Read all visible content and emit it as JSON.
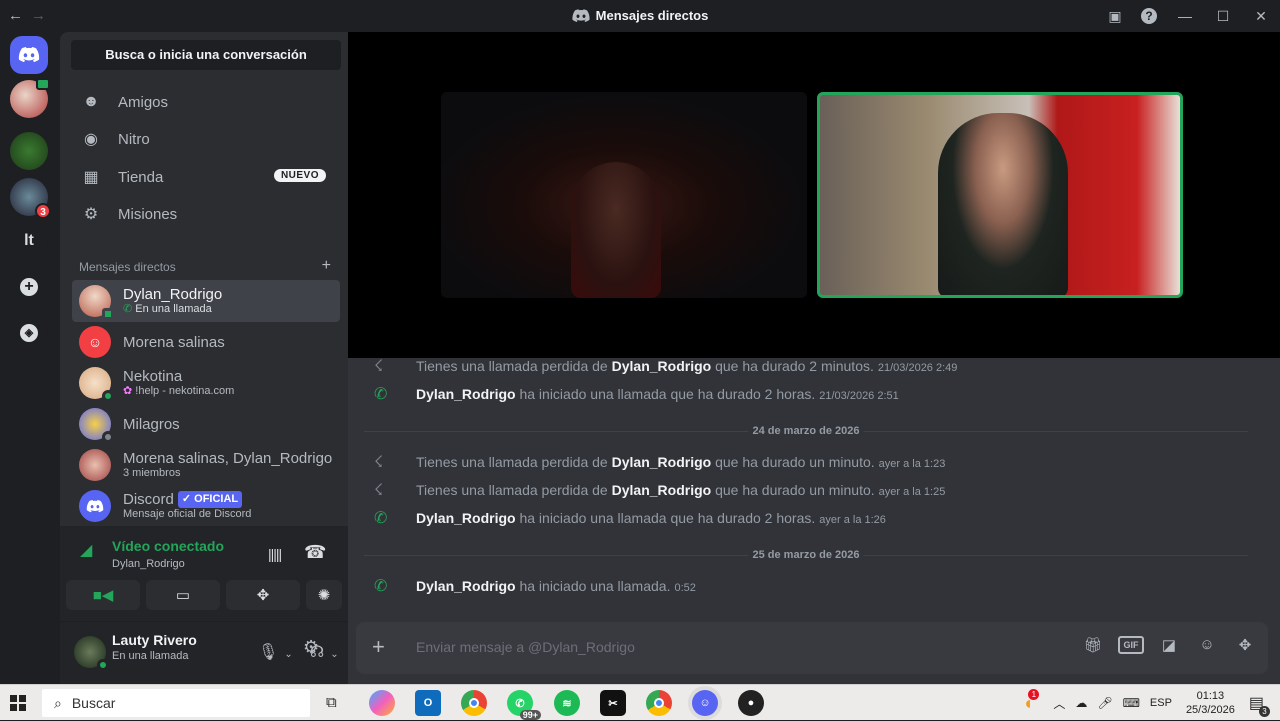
{
  "titlebar": {
    "title": "Mensajes directos",
    "back": "←",
    "forward": "→"
  },
  "sidebar": {
    "search": "Busca o inicia una conversación",
    "nav": [
      {
        "label": "Amigos",
        "icon": "friends-icon",
        "glyph": "☻"
      },
      {
        "label": "Nitro",
        "icon": "nitro-icon",
        "glyph": "◉"
      },
      {
        "label": "Tienda",
        "icon": "shop-icon",
        "glyph": "▦",
        "badge": "NUEVO"
      },
      {
        "label": "Misiones",
        "icon": "quests-icon",
        "glyph": "⚙"
      }
    ],
    "dm_header": "Mensajes directos",
    "dm_add": "+",
    "dms": [
      {
        "name": "Dylan_Rodrigo",
        "status": "En una llamada",
        "color": "#b85c4a",
        "dot": "#23a55a"
      },
      {
        "name": "Morena salinas",
        "status": "",
        "color": "#f23f43",
        "dot": ""
      },
      {
        "name": "Nekotina",
        "status": "!help - nekotina.com",
        "color": "#e8c4a0",
        "dot": "#23a55a"
      },
      {
        "name": "Milagros",
        "status": "",
        "color": "#5865f2",
        "dot": "#80848e"
      },
      {
        "name": "Morena salinas, Dylan_Rodrigo",
        "status": "3 miembros",
        "color": "#a04040",
        "dot": ""
      },
      {
        "name": "Discord",
        "badge": "✓ OFICIAL",
        "status": "Mensaje oficial de Discord",
        "color": "#5865f2",
        "dot": ""
      }
    ]
  },
  "voice": {
    "status": "Vídeo conectado",
    "channel": "Dylan_Rodrigo"
  },
  "user": {
    "name": "Lauty Rivero",
    "status": "En una llamada"
  },
  "guild_labels": {
    "lt": "lt",
    "badge": "3",
    "add": "+"
  },
  "messages": [
    {
      "type": "missed",
      "pre": "Tienes una llamada perdida de ",
      "who": "Dylan_Rodrigo",
      "post": " que ha durado 2 minutos.",
      "time": "21/03/2026 2:49"
    },
    {
      "type": "started",
      "pre": "",
      "who": "Dylan_Rodrigo",
      "post": " ha iniciado una llamada que ha durado 2 horas.",
      "time": "21/03/2026 2:51"
    },
    {
      "type": "divider",
      "label": "24 de marzo de 2026"
    },
    {
      "type": "missed",
      "pre": "Tienes una llamada perdida de ",
      "who": "Dylan_Rodrigo",
      "post": " que ha durado un minuto.",
      "time": "ayer a la 1:23"
    },
    {
      "type": "missed",
      "pre": "Tienes una llamada perdida de ",
      "who": "Dylan_Rodrigo",
      "post": " que ha durado un minuto.",
      "time": "ayer a la 1:25"
    },
    {
      "type": "started",
      "pre": "",
      "who": "Dylan_Rodrigo",
      "post": " ha iniciado una llamada que ha durado 2 horas.",
      "time": "ayer a la 1:26"
    },
    {
      "type": "divider",
      "label": "25 de marzo de 2026"
    },
    {
      "type": "started",
      "pre": "",
      "who": "Dylan_Rodrigo",
      "post": " ha iniciado una llamada.",
      "time": "0:52"
    }
  ],
  "composer": {
    "placeholder": "Enviar mensaje a @Dylan_Rodrigo"
  },
  "taskbar": {
    "search": "Buscar",
    "whatsapp_badge": "99+",
    "lang": "ESP",
    "time": "01:13",
    "date": "25/3/2026",
    "notif_count": "3",
    "weather_badge": "1"
  }
}
